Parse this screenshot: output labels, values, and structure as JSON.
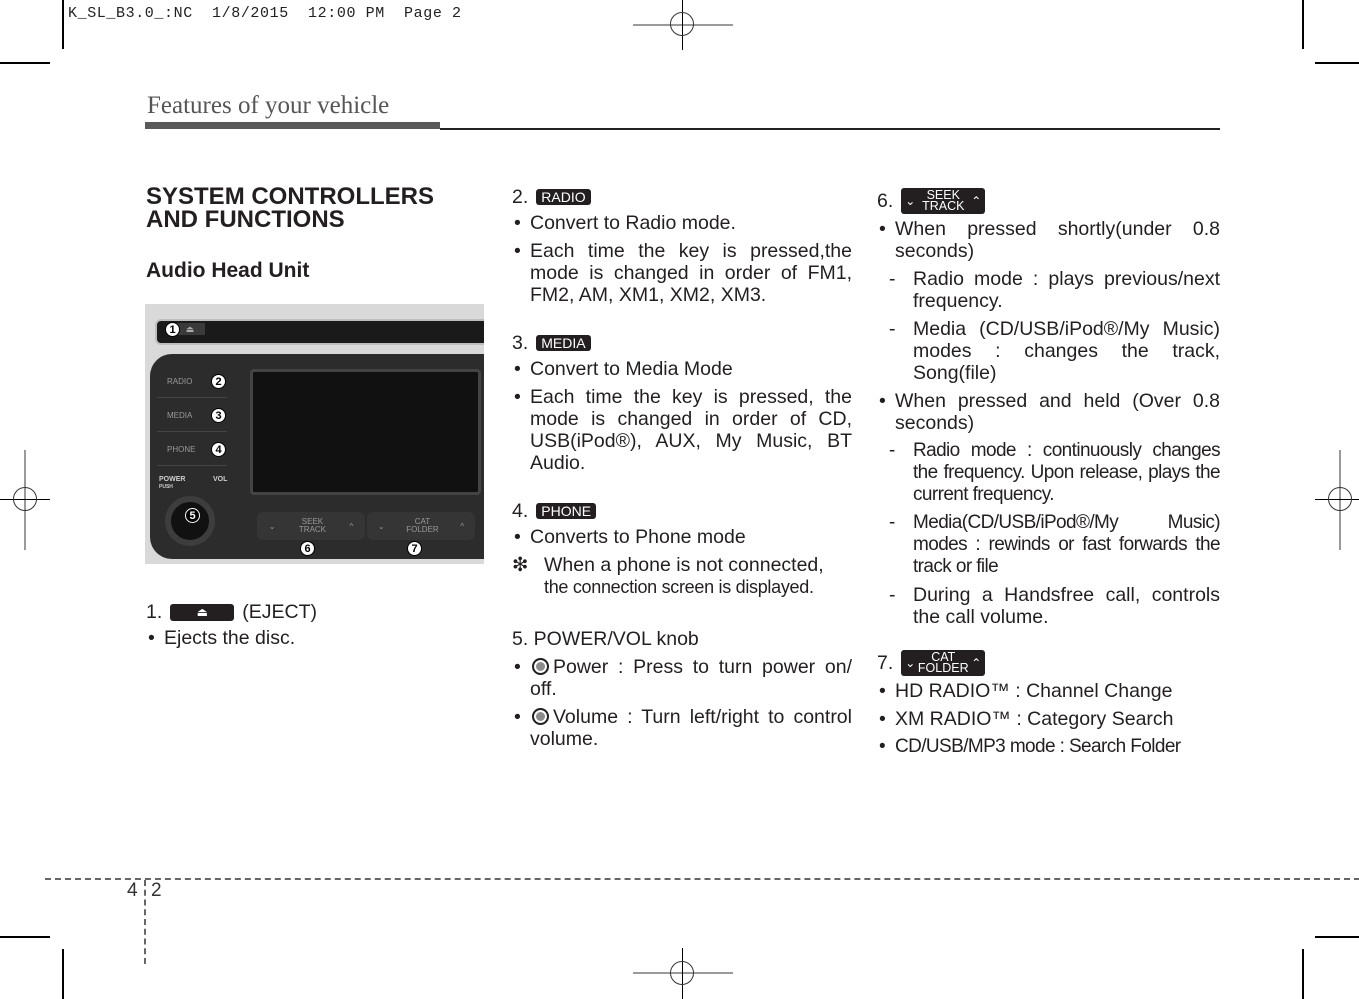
{
  "print_slug": "K_SL_B3.0_:NC  1/8/2015  12:00 PM  Page 2",
  "header": {
    "section_title": "Features of your vehicle"
  },
  "main": {
    "title_line1": "SYSTEM CONTROLLERS",
    "title_line2": "AND FUNCTIONS",
    "subtitle": "Audio Head Unit",
    "figure": {
      "slot_eject_glyph": "⏏",
      "buttons": [
        "RADIO",
        "MEDIA",
        "PHONE"
      ],
      "knob_label_power": "POWER",
      "knob_label_push": "PUSH",
      "knob_label_vol": "VOL",
      "seek_label": [
        "SEEK",
        "TRACK"
      ],
      "cat_label": [
        "CAT",
        "FOLDER"
      ],
      "chevron_down": "⌄",
      "chevron_up": "^",
      "callouts": [
        "1",
        "2",
        "3",
        "4",
        "5",
        "6",
        "7"
      ]
    },
    "items": [
      {
        "number": "1.",
        "key_glyph": "⏏",
        "key_suffix": "(EJECT)",
        "bullets": [
          "Ejects the disc."
        ]
      },
      {
        "number": "2.",
        "key_label": "RADIO",
        "bullets": [
          "Convert to Radio mode.",
          "Each time the key is pressed,the mode is changed in order of FM1, FM2, AM, XM1, XM2, XM3."
        ]
      },
      {
        "number": "3.",
        "key_label": "MEDIA",
        "bullets": [
          "Convert to Media Mode",
          "Each time the key is pressed, the mode is changed in order of CD, USB(iPod®), AUX, My Music, BT Audio."
        ]
      },
      {
        "number": "4.",
        "key_label": "PHONE",
        "bullets": [
          "Converts to Phone mode"
        ],
        "note_mark": "❇",
        "note_line1": "When a phone is not connected,",
        "note_line2": "the connection screen is displayed."
      },
      {
        "number_label": "5. POWER/VOL knob",
        "bullets": [
          "Power : Press to turn power on/ off.",
          "Volume : Turn left/right to control volume."
        ]
      },
      {
        "number": "6.",
        "key_top": "SEEK",
        "key_bottom": "TRACK",
        "bullets": [
          "When pressed shortly(under 0.8 seconds)",
          "When pressed and held (Over 0.8 seconds)"
        ],
        "short_press": [
          "Radio mode : plays previous/next frequency.",
          "Media (CD/USB/iPod®/My Music) modes : changes the track, Song(file)"
        ],
        "long_press": [
          "Radio mode : continuously changes the frequency. Upon release, plays the current frequency.",
          "Media(CD/USB/iPod®/My Music) modes : rewinds or fast forwards the track or file",
          "During a Handsfree call, controls the call volume."
        ],
        "dash_mark": "-"
      },
      {
        "number": "7.",
        "key_top": "CAT",
        "key_bottom": "FOLDER",
        "bullets": [
          "HD RADIO™ : Channel Change",
          "XM RADIO™ : Category Search",
          "CD/USB/MP3 mode : Search Folder"
        ]
      }
    ]
  },
  "footer": {
    "chapter": "4",
    "page": "2"
  }
}
